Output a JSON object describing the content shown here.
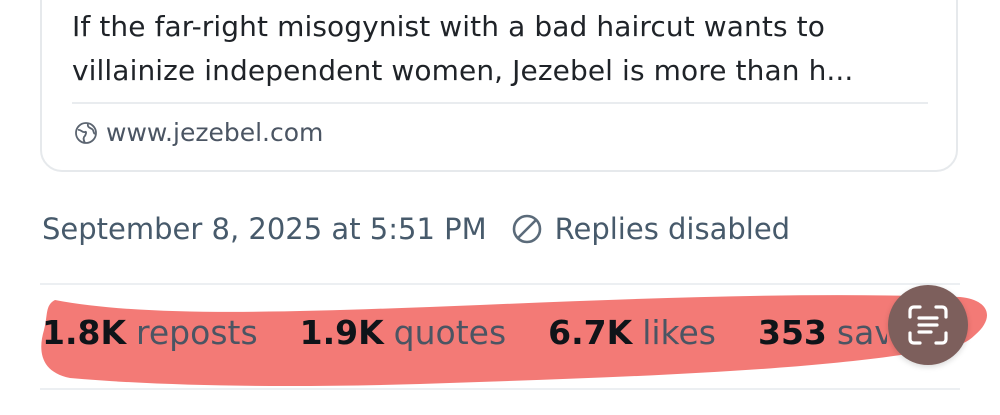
{
  "link_card": {
    "description": "If the far-right misogynist with a bad haircut wants to villainize independent women, Jezebel is more than h...",
    "domain": "www.jezebel.com",
    "domain_icon": "globe-icon"
  },
  "post_meta": {
    "timestamp": "September 8, 2025 at 5:51 PM",
    "replies_icon": "ban-icon",
    "replies_status": "Replies disabled"
  },
  "stats": [
    {
      "count": "1.8K",
      "label": "reposts"
    },
    {
      "count": "1.9K",
      "label": "quotes"
    },
    {
      "count": "6.7K",
      "label": "likes"
    },
    {
      "count": "353",
      "label": "saves"
    }
  ],
  "overlay": {
    "scan_button_icon": "live-text-scan-icon",
    "highlight_color": "#f26b67"
  },
  "colors": {
    "text_primary": "#0f1419",
    "text_secondary": "#475a6b",
    "divider": "#eceff2",
    "scan_button_bg": "#7d5f5c"
  }
}
